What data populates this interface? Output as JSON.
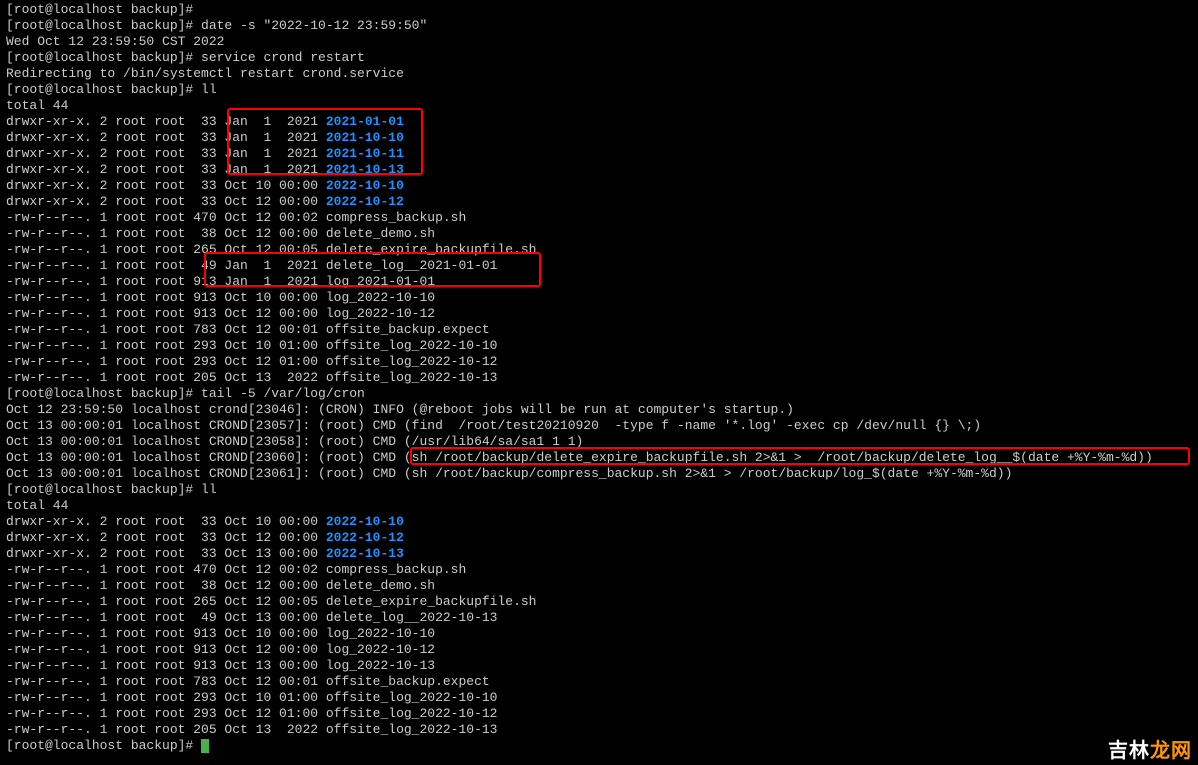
{
  "prompts": {
    "p0": "[root@localhost backup]# ",
    "p1": "[root@localhost backup]# date -s \"2022-10-12 23:59:50\"",
    "p1out": "Wed Oct 12 23:59:50 CST 2022",
    "p2": "[root@localhost backup]# service crond restart",
    "p2out": "Redirecting to /bin/systemctl restart crond.service",
    "p3": "[root@localhost backup]# ll",
    "p4": "total 44",
    "p5": "[root@localhost backup]# tail -5 /var/log/cron",
    "p6": "[root@localhost backup]# ll",
    "p7": "total 44",
    "p8": "[root@localhost backup]# "
  },
  "listing1": [
    {
      "perm": "drwxr-xr-x.",
      "n": "2",
      "u": "root",
      "g": "root",
      "size": " 33",
      "date": "Jan  1  2021",
      "name": "2021-01-01",
      "dir": true
    },
    {
      "perm": "drwxr-xr-x.",
      "n": "2",
      "u": "root",
      "g": "root",
      "size": " 33",
      "date": "Jan  1  2021",
      "name": "2021-10-10",
      "dir": true
    },
    {
      "perm": "drwxr-xr-x.",
      "n": "2",
      "u": "root",
      "g": "root",
      "size": " 33",
      "date": "Jan  1  2021",
      "name": "2021-10-11",
      "dir": true
    },
    {
      "perm": "drwxr-xr-x.",
      "n": "2",
      "u": "root",
      "g": "root",
      "size": " 33",
      "date": "Jan  1  2021",
      "name": "2021-10-13",
      "dir": true
    },
    {
      "perm": "drwxr-xr-x.",
      "n": "2",
      "u": "root",
      "g": "root",
      "size": " 33",
      "date": "Oct 10 00:00",
      "name": "2022-10-10",
      "dir": true
    },
    {
      "perm": "drwxr-xr-x.",
      "n": "2",
      "u": "root",
      "g": "root",
      "size": " 33",
      "date": "Oct 12 00:00",
      "name": "2022-10-12",
      "dir": true
    },
    {
      "perm": "-rw-r--r--.",
      "n": "1",
      "u": "root",
      "g": "root",
      "size": "470",
      "date": "Oct 12 00:02",
      "name": "compress_backup.sh",
      "dir": false
    },
    {
      "perm": "-rw-r--r--.",
      "n": "1",
      "u": "root",
      "g": "root",
      "size": " 38",
      "date": "Oct 12 00:00",
      "name": "delete_demo.sh",
      "dir": false
    },
    {
      "perm": "-rw-r--r--.",
      "n": "1",
      "u": "root",
      "g": "root",
      "size": "265",
      "date": "Oct 12 00:05",
      "name": "delete_expire_backupfile.sh",
      "dir": false
    },
    {
      "perm": "-rw-r--r--.",
      "n": "1",
      "u": "root",
      "g": "root",
      "size": " 49",
      "date": "Jan  1  2021",
      "name": "delete_log__2021-01-01",
      "dir": false
    },
    {
      "perm": "-rw-r--r--.",
      "n": "1",
      "u": "root",
      "g": "root",
      "size": "913",
      "date": "Jan  1  2021",
      "name": "log_2021-01-01",
      "dir": false
    },
    {
      "perm": "-rw-r--r--.",
      "n": "1",
      "u": "root",
      "g": "root",
      "size": "913",
      "date": "Oct 10 00:00",
      "name": "log_2022-10-10",
      "dir": false
    },
    {
      "perm": "-rw-r--r--.",
      "n": "1",
      "u": "root",
      "g": "root",
      "size": "913",
      "date": "Oct 12 00:00",
      "name": "log_2022-10-12",
      "dir": false
    },
    {
      "perm": "-rw-r--r--.",
      "n": "1",
      "u": "root",
      "g": "root",
      "size": "783",
      "date": "Oct 12 00:01",
      "name": "offsite_backup.expect",
      "dir": false
    },
    {
      "perm": "-rw-r--r--.",
      "n": "1",
      "u": "root",
      "g": "root",
      "size": "293",
      "date": "Oct 10 01:00",
      "name": "offsite_log_2022-10-10",
      "dir": false
    },
    {
      "perm": "-rw-r--r--.",
      "n": "1",
      "u": "root",
      "g": "root",
      "size": "293",
      "date": "Oct 12 01:00",
      "name": "offsite_log_2022-10-12",
      "dir": false
    },
    {
      "perm": "-rw-r--r--.",
      "n": "1",
      "u": "root",
      "g": "root",
      "size": "205",
      "date": "Oct 13  2022",
      "name": "offsite_log_2022-10-13",
      "dir": false
    }
  ],
  "cron": [
    "Oct 12 23:59:50 localhost crond[23046]: (CRON) INFO (@reboot jobs will be run at computer's startup.)",
    "Oct 13 00:00:01 localhost CROND[23057]: (root) CMD (find  /root/test20210920  -type f -name '*.log' -exec cp /dev/null {} \\;)",
    "Oct 13 00:00:01 localhost CROND[23058]: (root) CMD (/usr/lib64/sa/sa1 1 1)",
    "Oct 13 00:00:01 localhost CROND[23060]: (root) CMD (sh /root/backup/delete_expire_backupfile.sh 2>&1 >  /root/backup/delete_log__$(date +%Y-%m-%d))",
    "Oct 13 00:00:01 localhost CROND[23061]: (root) CMD (sh /root/backup/compress_backup.sh 2>&1 > /root/backup/log_$(date +%Y-%m-%d))"
  ],
  "listing2": [
    {
      "perm": "drwxr-xr-x.",
      "n": "2",
      "u": "root",
      "g": "root",
      "size": " 33",
      "date": "Oct 10 00:00",
      "name": "2022-10-10",
      "dir": true
    },
    {
      "perm": "drwxr-xr-x.",
      "n": "2",
      "u": "root",
      "g": "root",
      "size": " 33",
      "date": "Oct 12 00:00",
      "name": "2022-10-12",
      "dir": true
    },
    {
      "perm": "drwxr-xr-x.",
      "n": "2",
      "u": "root",
      "g": "root",
      "size": " 33",
      "date": "Oct 13 00:00",
      "name": "2022-10-13",
      "dir": true
    },
    {
      "perm": "-rw-r--r--.",
      "n": "1",
      "u": "root",
      "g": "root",
      "size": "470",
      "date": "Oct 12 00:02",
      "name": "compress_backup.sh",
      "dir": false
    },
    {
      "perm": "-rw-r--r--.",
      "n": "1",
      "u": "root",
      "g": "root",
      "size": " 38",
      "date": "Oct 12 00:00",
      "name": "delete_demo.sh",
      "dir": false
    },
    {
      "perm": "-rw-r--r--.",
      "n": "1",
      "u": "root",
      "g": "root",
      "size": "265",
      "date": "Oct 12 00:05",
      "name": "delete_expire_backupfile.sh",
      "dir": false
    },
    {
      "perm": "-rw-r--r--.",
      "n": "1",
      "u": "root",
      "g": "root",
      "size": " 49",
      "date": "Oct 13 00:00",
      "name": "delete_log__2022-10-13",
      "dir": false
    },
    {
      "perm": "-rw-r--r--.",
      "n": "1",
      "u": "root",
      "g": "root",
      "size": "913",
      "date": "Oct 10 00:00",
      "name": "log_2022-10-10",
      "dir": false
    },
    {
      "perm": "-rw-r--r--.",
      "n": "1",
      "u": "root",
      "g": "root",
      "size": "913",
      "date": "Oct 12 00:00",
      "name": "log_2022-10-12",
      "dir": false
    },
    {
      "perm": "-rw-r--r--.",
      "n": "1",
      "u": "root",
      "g": "root",
      "size": "913",
      "date": "Oct 13 00:00",
      "name": "log_2022-10-13",
      "dir": false
    },
    {
      "perm": "-rw-r--r--.",
      "n": "1",
      "u": "root",
      "g": "root",
      "size": "783",
      "date": "Oct 12 00:01",
      "name": "offsite_backup.expect",
      "dir": false
    },
    {
      "perm": "-rw-r--r--.",
      "n": "1",
      "u": "root",
      "g": "root",
      "size": "293",
      "date": "Oct 10 01:00",
      "name": "offsite_log_2022-10-10",
      "dir": false
    },
    {
      "perm": "-rw-r--r--.",
      "n": "1",
      "u": "root",
      "g": "root",
      "size": "293",
      "date": "Oct 12 01:00",
      "name": "offsite_log_2022-10-12",
      "dir": false
    },
    {
      "perm": "-rw-r--r--.",
      "n": "1",
      "u": "root",
      "g": "root",
      "size": "205",
      "date": "Oct 13  2022",
      "name": "offsite_log_2022-10-13",
      "dir": false
    }
  ],
  "watermark": {
    "a": "吉林",
    "b": "龙网"
  }
}
